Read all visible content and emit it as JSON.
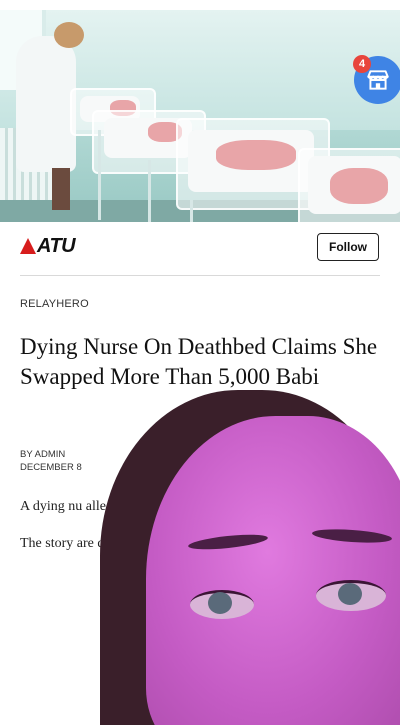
{
  "hero": {
    "store_icon": "storefront-icon",
    "notification_count": "4"
  },
  "publisher": {
    "logo_text": "ATU",
    "follow_label": "Follow"
  },
  "article": {
    "source": "RELAYHERO",
    "headline": "Dying Nurse On Deathbed Claims She Swapped More Than 5,000 Babi",
    "byline_author": "BY ADMIN",
    "byline_date": "DECEMBER 8",
    "paragraph1": "A dying nu alleged to simply for give her Should hoax?",
    "paragraph2": "The story are disturb"
  },
  "colors": {
    "accent_blue": "#3f84e5",
    "badge_red": "#e8453c",
    "logo_red": "#d71d1d"
  }
}
